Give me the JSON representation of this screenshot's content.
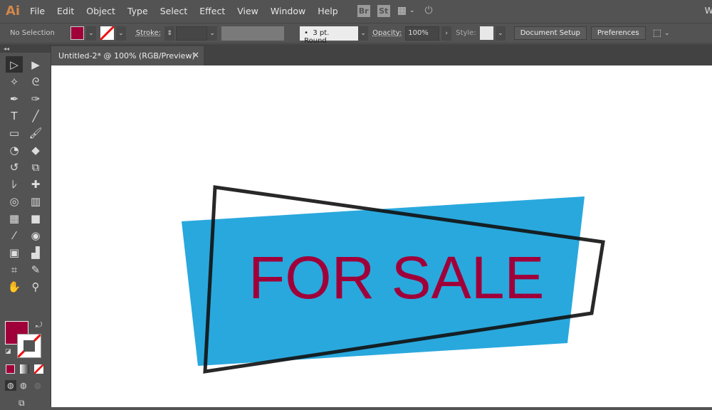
{
  "app": {
    "logo": "Ai",
    "menus": [
      "File",
      "Edit",
      "Object",
      "Type",
      "Select",
      "Effect",
      "View",
      "Window",
      "Help"
    ],
    "bridge": "Br",
    "stock": "St",
    "right_cut": "W"
  },
  "control": {
    "selection": "No Selection",
    "fill_color": "#a0003a",
    "stroke_label": "Stroke:",
    "brush": "3 pt. Round",
    "opacity_label": "Opacity:",
    "opacity": "100%",
    "style_label": "Style:",
    "document_setup": "Document Setup",
    "preferences": "Preferences"
  },
  "tab": {
    "title": "Untitled-2* @ 100% (RGB/Preview)",
    "close": "×"
  },
  "tools": [
    {
      "name": "selection",
      "glyph": "▷"
    },
    {
      "name": "direct-selection",
      "glyph": "▶"
    },
    {
      "name": "magic-wand",
      "glyph": "✧"
    },
    {
      "name": "lasso",
      "glyph": "ᘓ"
    },
    {
      "name": "pen",
      "glyph": "✒"
    },
    {
      "name": "curvature",
      "glyph": "✑"
    },
    {
      "name": "type",
      "glyph": "T"
    },
    {
      "name": "line",
      "glyph": "╱"
    },
    {
      "name": "rectangle",
      "glyph": "▭"
    },
    {
      "name": "paintbrush",
      "glyph": "🖌"
    },
    {
      "name": "shaper",
      "glyph": "◔"
    },
    {
      "name": "eraser",
      "glyph": "◆"
    },
    {
      "name": "rotate",
      "glyph": "↺"
    },
    {
      "name": "scale",
      "glyph": "⧉"
    },
    {
      "name": "warp",
      "glyph": "ﾚ"
    },
    {
      "name": "puppet-warp",
      "glyph": "✚"
    },
    {
      "name": "shape-builder",
      "glyph": "◎"
    },
    {
      "name": "perspective-grid",
      "glyph": "▥"
    },
    {
      "name": "mesh",
      "glyph": "▦"
    },
    {
      "name": "gradient",
      "glyph": "■"
    },
    {
      "name": "eyedropper",
      "glyph": "⁄"
    },
    {
      "name": "blend",
      "glyph": "◉"
    },
    {
      "name": "symbol-sprayer",
      "glyph": "▣"
    },
    {
      "name": "column-graph",
      "glyph": "▟"
    },
    {
      "name": "artboard",
      "glyph": "⌗"
    },
    {
      "name": "slice",
      "glyph": "✎"
    },
    {
      "name": "hand",
      "glyph": "✋"
    },
    {
      "name": "zoom",
      "glyph": "⚲"
    }
  ],
  "artwork": {
    "text": "FOR SALE",
    "text_color": "#a0003a",
    "banner_color": "#29a8dd",
    "outline_color": "#111111"
  }
}
